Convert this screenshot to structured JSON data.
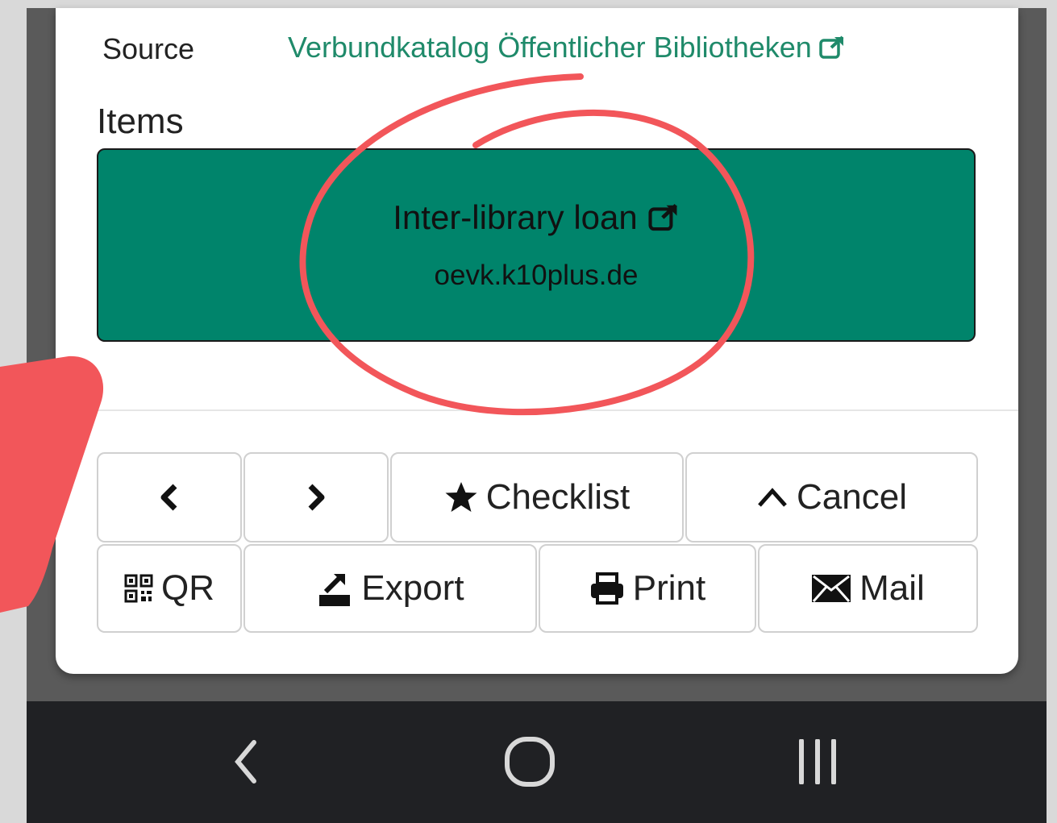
{
  "source": {
    "label": "Source",
    "link_text": "Verbundkatalog Öffentlicher Bibliotheken"
  },
  "items": {
    "heading": "Items",
    "loan": {
      "title": "Inter-library loan",
      "url": "oevk.k10plus.de"
    }
  },
  "toolbar": {
    "checklist": "Checklist",
    "cancel": "Cancel",
    "qr": "QR",
    "export": "Export",
    "print": "Print",
    "mail": "Mail"
  },
  "colors": {
    "accent_green": "#00846b",
    "link_green": "#1f8a6a",
    "annotation_red": "#f2565a",
    "nav_bar": "#202124"
  },
  "icons": [
    "external-link-icon",
    "chevron-left-icon",
    "chevron-right-icon",
    "star-icon",
    "caret-up-icon",
    "qr-code-icon",
    "export-icon",
    "print-icon",
    "mail-icon",
    "nav-back-icon",
    "nav-home-icon",
    "nav-recents-icon"
  ]
}
